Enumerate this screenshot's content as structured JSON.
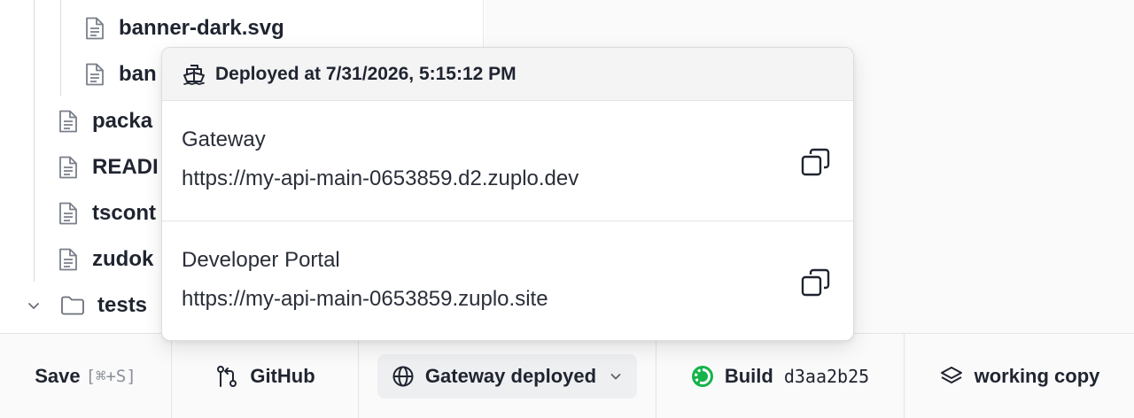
{
  "file_tree": {
    "items": [
      {
        "label": "banner-dark.svg",
        "type": "file"
      },
      {
        "label": "ban",
        "type": "file"
      },
      {
        "label": "packa",
        "type": "file"
      },
      {
        "label": "READI",
        "type": "file"
      },
      {
        "label": "tscont",
        "type": "file"
      },
      {
        "label": "zudok",
        "type": "file"
      },
      {
        "label": "tests",
        "type": "folder"
      }
    ]
  },
  "popover": {
    "header": "Deployed at 7/31/2026, 5:15:12 PM",
    "sections": [
      {
        "label": "Gateway",
        "url": "https://my-api-main-0653859.d2.zuplo.dev"
      },
      {
        "label": "Developer Portal",
        "url": "https://my-api-main-0653859.zuplo.site"
      }
    ]
  },
  "statusbar": {
    "save_label": "Save",
    "save_shortcut": "[⌘+S]",
    "github_label": "GitHub",
    "gateway_label": "Gateway deployed",
    "build_label": "Build",
    "build_hash": "d3aa2b25",
    "working_label": "working copy"
  },
  "colors": {
    "build_status": "#16b34a",
    "text": "#1f2430"
  }
}
